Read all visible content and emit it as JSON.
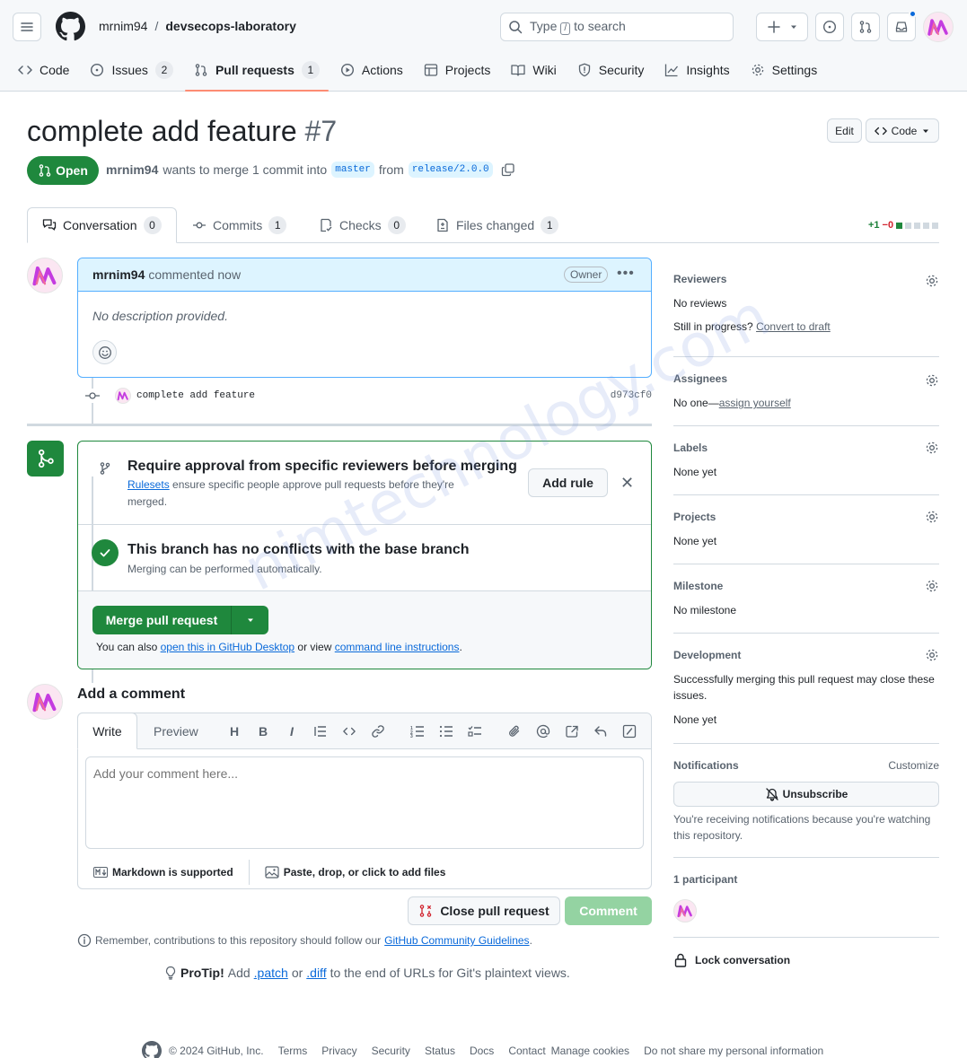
{
  "header": {
    "owner": "mrnim94",
    "separator": "/",
    "repo": "devsecops-laboratory",
    "search_placeholder_pre": "Type",
    "search_key": "/",
    "search_placeholder_post": "to search"
  },
  "nav": {
    "items": [
      {
        "label": "Code",
        "icon": "code-icon"
      },
      {
        "label": "Issues",
        "icon": "issue-opened-icon",
        "count": "2"
      },
      {
        "label": "Pull requests",
        "icon": "git-pull-request-icon",
        "count": "1",
        "active": true
      },
      {
        "label": "Actions",
        "icon": "play-icon"
      },
      {
        "label": "Projects",
        "icon": "table-icon"
      },
      {
        "label": "Wiki",
        "icon": "book-icon"
      },
      {
        "label": "Security",
        "icon": "shield-icon"
      },
      {
        "label": "Insights",
        "icon": "graph-icon"
      },
      {
        "label": "Settings",
        "icon": "gear-icon"
      }
    ]
  },
  "pr": {
    "title": "complete add feature",
    "number": "#7",
    "edit_label": "Edit",
    "code_label": "Code",
    "state": "Open",
    "author": "mrnim94",
    "merge_text": "wants to merge 1 commit into",
    "base_branch": "master",
    "from_text": "from",
    "head_branch": "release/2.0.0"
  },
  "tabs": [
    {
      "label": "Conversation",
      "count": "0"
    },
    {
      "label": "Commits",
      "count": "1"
    },
    {
      "label": "Checks",
      "count": "0"
    },
    {
      "label": "Files changed",
      "count": "1"
    }
  ],
  "diffstat": {
    "additions": "+1",
    "deletions": "−0"
  },
  "comment": {
    "author": "mrnim94",
    "action": "commented now",
    "badge": "Owner",
    "body": "No description provided."
  },
  "commit": {
    "message": "complete add feature",
    "sha": "d973cf0"
  },
  "merge": {
    "rule_title": "Require approval from specific reviewers before merging",
    "rule_link": "Rulesets",
    "rule_desc_1": "ensure specific people approve pull requests before they're",
    "rule_desc_2": "merged.",
    "add_rule_label": "Add rule",
    "conflict_title": "This branch has no conflicts with the base branch",
    "conflict_sub": "Merging can be performed automatically.",
    "merge_label": "Merge pull request",
    "also_pre": "You can also",
    "also_link1": "open this in GitHub Desktop",
    "also_mid": "or view",
    "also_link2": "command line instructions",
    "also_post": "."
  },
  "add_comment": {
    "title": "Add a comment",
    "write_tab": "Write",
    "preview_tab": "Preview",
    "placeholder": "Add your comment here...",
    "markdown_note": "Markdown is supported",
    "files_note": "Paste, drop, or click to add files",
    "close_label": "Close pull request",
    "comment_label": "Comment"
  },
  "remember": {
    "pre": "Remember, contributions to this repository should follow our",
    "link": "GitHub Community Guidelines",
    "post": "."
  },
  "protip": {
    "label": "ProTip!",
    "pre": "Add",
    "patch": ".patch",
    "or": "or",
    "diff": ".diff",
    "post": "to the end of URLs for Git's plaintext views."
  },
  "sidebar": {
    "reviewers": {
      "title": "Reviewers",
      "value": "No reviews",
      "progress_q": "Still in progress?",
      "draft_link": "Convert to draft"
    },
    "assignees": {
      "title": "Assignees",
      "value_pre": "No one—",
      "assign_link": "assign yourself"
    },
    "labels": {
      "title": "Labels",
      "value": "None yet"
    },
    "projects": {
      "title": "Projects",
      "value": "None yet"
    },
    "milestone": {
      "title": "Milestone",
      "value": "No milestone"
    },
    "development": {
      "title": "Development",
      "desc": "Successfully merging this pull request may close these issues.",
      "value": "None yet"
    },
    "notifications": {
      "title": "Notifications",
      "customize": "Customize",
      "unsubscribe": "Unsubscribe",
      "reason": "You're receiving notifications because you're watching this repository."
    },
    "participants": {
      "title": "1 participant"
    },
    "lock": "Lock conversation"
  },
  "footer": {
    "copyright": "© 2024 GitHub, Inc.",
    "links": [
      "Terms",
      "Privacy",
      "Security",
      "Status",
      "Docs",
      "Contact",
      "Manage cookies",
      "Do not share my personal information"
    ]
  },
  "watermark": "nimtechnology.com",
  "colors": {
    "accent_green": "#1f883d",
    "link_blue": "#0969da",
    "active_tab_underline": "#fd8c73"
  }
}
